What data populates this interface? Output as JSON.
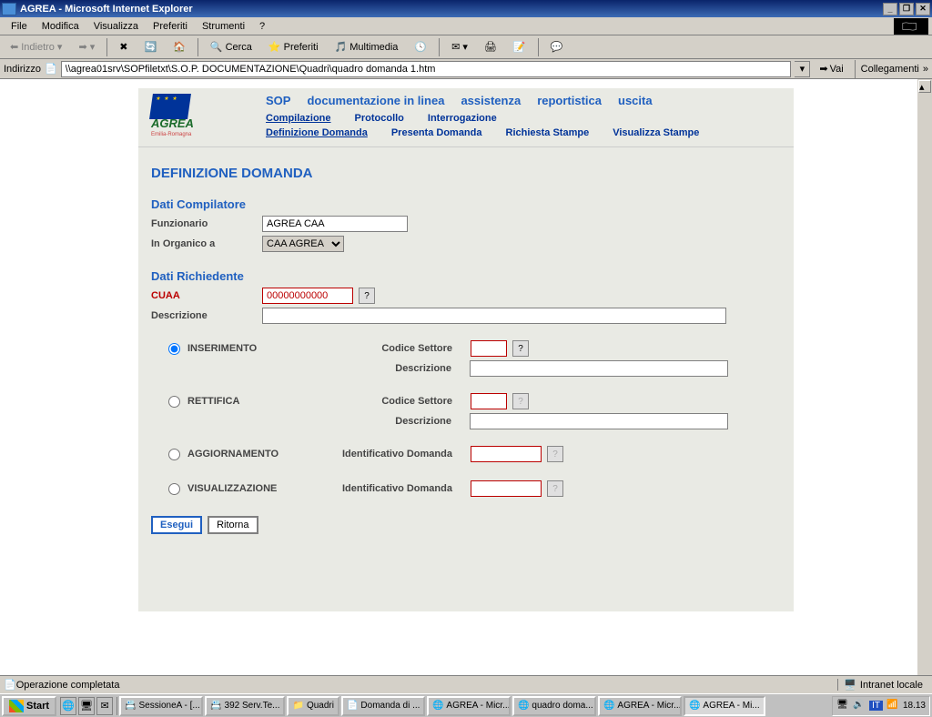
{
  "window": {
    "title": "AGREA - Microsoft Internet Explorer",
    "min": "_",
    "max": "❐",
    "close": "✕"
  },
  "menu": {
    "file": "File",
    "modifica": "Modifica",
    "visualizza": "Visualizza",
    "preferiti": "Preferiti",
    "strumenti": "Strumenti",
    "help": "?"
  },
  "toolbar": {
    "indietro": "Indietro",
    "cerca": "Cerca",
    "preferiti": "Preferiti",
    "multimedia": "Multimedia"
  },
  "address": {
    "label": "Indirizzo",
    "value": "\\\\agrea01srv\\SOPfiletxt\\S.O.P. DOCUMENTAZIONE\\Quadri\\quadro domanda 1.htm",
    "vai": "Vai",
    "collegamenti": "Collegamenti"
  },
  "logo": {
    "brand": "AGREA",
    "sub": "Emilia-Romagna"
  },
  "nav": {
    "top": [
      "SOP",
      "documentazione in linea",
      "assistenza",
      "reportistica",
      "uscita"
    ],
    "mid": [
      "Compilazione",
      "Protocollo",
      "Interrogazione"
    ],
    "bot": [
      "Definizione Domanda",
      "Presenta Domanda",
      "Richiesta Stampe",
      "Visualizza Stampe"
    ]
  },
  "page": {
    "title": "DEFINIZIONE DOMANDA",
    "compilatore": {
      "heading": "Dati Compilatore",
      "funzionario_label": "Funzionario",
      "funzionario_value": "AGREA CAA",
      "organico_label": "In Organico a",
      "organico_value": "CAA AGREA"
    },
    "richiedente": {
      "heading": "Dati Richiedente",
      "cuaa_label": "CUAA",
      "cuaa_value": "00000000000",
      "desc_label": "Descrizione",
      "desc_value": ""
    },
    "options": {
      "inserimento": "INSERIMENTO",
      "rettifica": "RETTIFICA",
      "aggiornamento": "AGGIORNAMENTO",
      "visualizzazione": "VISUALIZZAZIONE",
      "codice_settore": "Codice Settore",
      "descrizione": "Descrizione",
      "identificativo": "Identificativo Domanda",
      "help": "?"
    },
    "buttons": {
      "esegui": "Esegui",
      "ritorna": "Ritorna"
    }
  },
  "status": {
    "msg": "Operazione completata",
    "zone": "Intranet locale"
  },
  "taskbar": {
    "start": "Start",
    "tasks": [
      "SessioneA - [...",
      "392 Serv.Te...",
      "Quadri",
      "Domanda di ...",
      "AGREA - Micr...",
      "quadro doma...",
      "AGREA - Micr...",
      "AGREA - Mi..."
    ],
    "lang": "IT",
    "time": "18.13"
  }
}
